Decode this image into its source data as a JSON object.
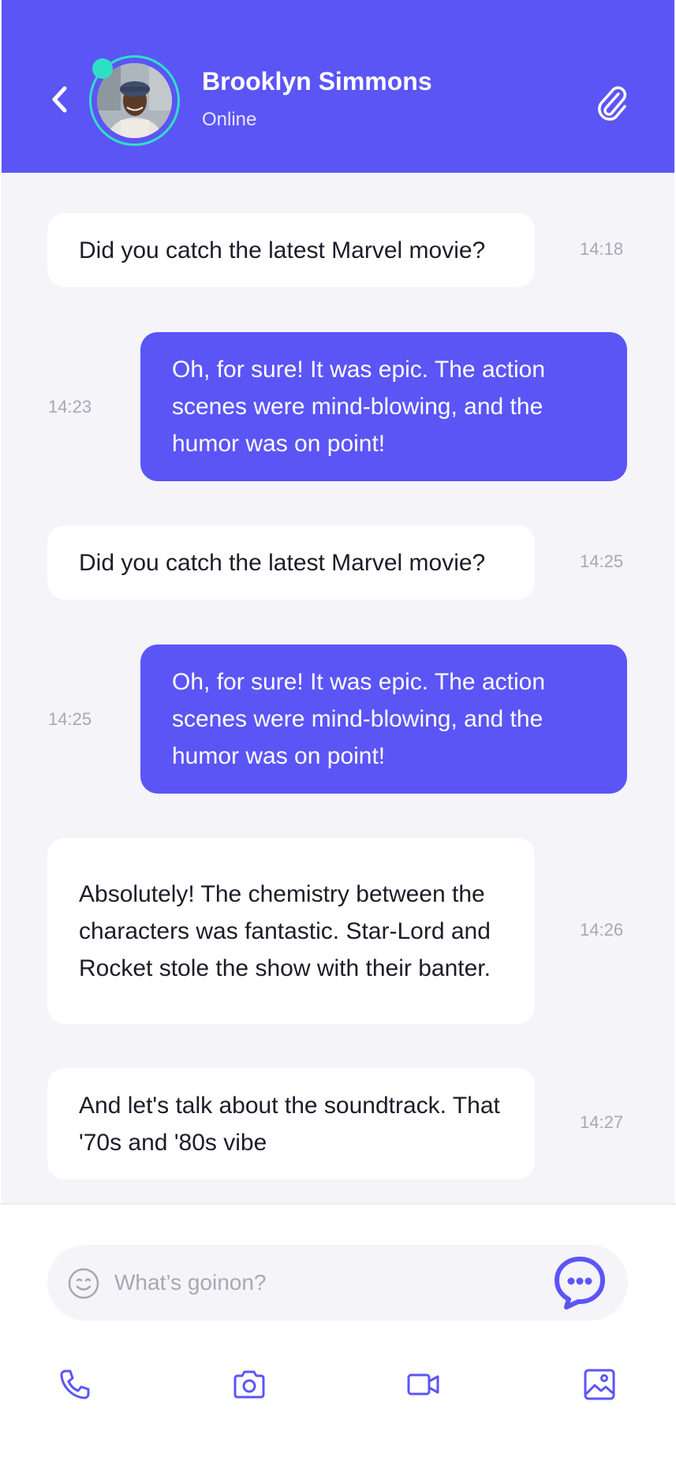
{
  "colors": {
    "accent": "#5b55f6",
    "online": "#2ee0c3",
    "background": "#f4f4f9",
    "incoming_bubble": "#ffffff",
    "timestamp": "#a8a8b3"
  },
  "header": {
    "back_icon": "chevron-left-icon",
    "contact_name": "Brooklyn Simmons",
    "status": "Online",
    "attach_icon": "paperclip-icon"
  },
  "messages": [
    {
      "direction": "incoming",
      "text": "Did you catch the latest Marvel movie?",
      "time": "14:18"
    },
    {
      "direction": "outgoing",
      "text": "Oh, for sure! It was epic. The action scenes were mind-blowing, and the humor was on point!",
      "time": "14:23"
    },
    {
      "direction": "incoming",
      "text": "Did you catch the latest Marvel movie?",
      "time": "14:25"
    },
    {
      "direction": "outgoing",
      "text": "Oh, for sure! It was epic. The action scenes were mind-blowing, and the humor was on point!",
      "time": "14:25"
    },
    {
      "direction": "incoming",
      "text": "Absolutely! The chemistry between the characters was fantastic. Star-Lord and Rocket stole the show with their banter.",
      "time": "14:26"
    },
    {
      "direction": "incoming",
      "text": "And let's talk about the soundtrack. That '70s and '80s vibe",
      "time": "14:27"
    }
  ],
  "composer": {
    "placeholder": "What’s goinon?",
    "value": "",
    "emoji_icon": "smiley-icon",
    "send_icon": "chat-bubble-icon"
  },
  "bottom_bar": {
    "items": [
      {
        "icon": "phone-icon"
      },
      {
        "icon": "camera-icon"
      },
      {
        "icon": "video-icon"
      },
      {
        "icon": "image-icon"
      }
    ]
  }
}
